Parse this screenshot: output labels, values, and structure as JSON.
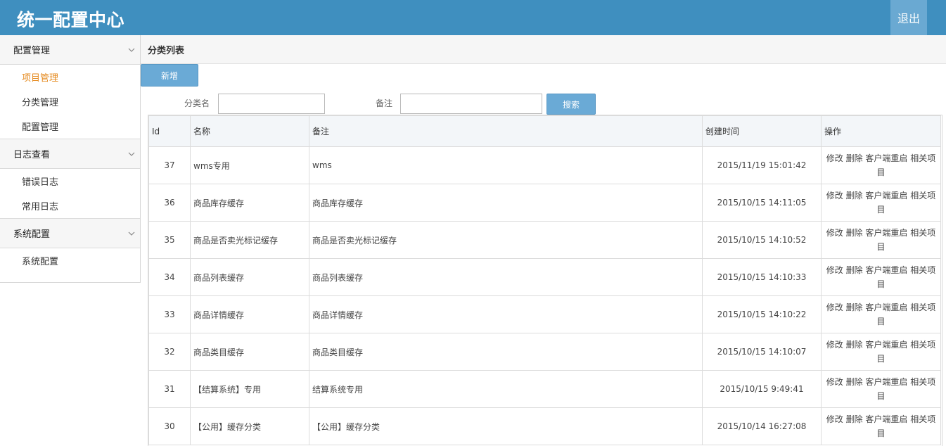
{
  "header": {
    "title": "统一配置中心",
    "logout_label": "退出"
  },
  "sidebar": {
    "groups": [
      {
        "label": "配置管理",
        "items": [
          "项目管理",
          "分类管理",
          "配置管理"
        ]
      },
      {
        "label": "日志查看",
        "items": [
          "错误日志",
          "常用日志"
        ]
      },
      {
        "label": "系统配置",
        "items": [
          "系统配置"
        ]
      }
    ],
    "active_item": "项目管理"
  },
  "main": {
    "section_title": "分类列表",
    "add_button": "新增",
    "search": {
      "name_label": "分类名",
      "name_value": "",
      "remark_label": "备注",
      "remark_value": "",
      "button": "搜索"
    },
    "table": {
      "columns": [
        "Id",
        "名称",
        "备注",
        "创建时间",
        "操作"
      ],
      "rows": [
        {
          "id": "37",
          "name": "wms专用",
          "remark": "wms",
          "created": "2015/11/19 15:01:42"
        },
        {
          "id": "36",
          "name": "商品库存缓存",
          "remark": "商品库存缓存",
          "created": "2015/10/15 14:11:05"
        },
        {
          "id": "35",
          "name": "商品是否卖光标记缓存",
          "remark": "商品是否卖光标记缓存",
          "created": "2015/10/15 14:10:52"
        },
        {
          "id": "34",
          "name": "商品列表缓存",
          "remark": "商品列表缓存",
          "created": "2015/10/15 14:10:33"
        },
        {
          "id": "33",
          "name": "商品详情缓存",
          "remark": "商品详情缓存",
          "created": "2015/10/15 14:10:22"
        },
        {
          "id": "32",
          "name": "商品类目缓存",
          "remark": "商品类目缓存",
          "created": "2015/10/15 14:10:07"
        },
        {
          "id": "31",
          "name": "【结算系统】专用",
          "remark": "结算系统专用",
          "created": "2015/10/15 9:49:41"
        },
        {
          "id": "30",
          "name": "【公用】缓存分类",
          "remark": "【公用】缓存分类",
          "created": "2015/10/14 16:27:08"
        }
      ],
      "row_actions": [
        "修改",
        "删除",
        "客户端重启",
        "相关项目"
      ]
    }
  }
}
